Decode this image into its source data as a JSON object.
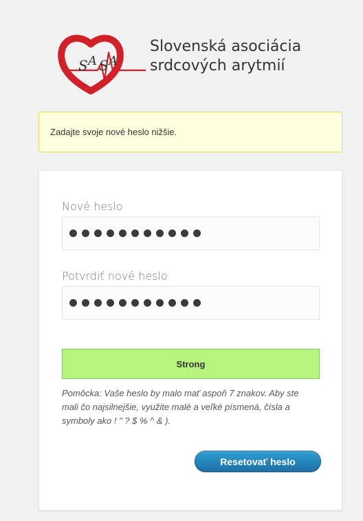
{
  "logo": {
    "mark_text": "SASA",
    "line1": "Slovenská asociácia",
    "line2": "srdcových arytmií",
    "accent_color": "#d0212b"
  },
  "message": {
    "text": "Zadajte svoje nové heslo nižšie."
  },
  "form": {
    "new_password": {
      "label": "Nové heslo",
      "masked_length": 11
    },
    "confirm_password": {
      "label": "Potvrdiť nové heslo",
      "masked_length": 11
    },
    "strength": {
      "label": "Strong",
      "color": "#b7f47e"
    },
    "hint": "Pomôcka: Vaše heslo by malo mať aspoň 7 znakov. Aby ste mali čo najsilnejšie, využite malé a veľké písmená, čísla a symboly ako ! \" ? $ % ^ & ).",
    "reset_button": "Resetovať heslo"
  }
}
